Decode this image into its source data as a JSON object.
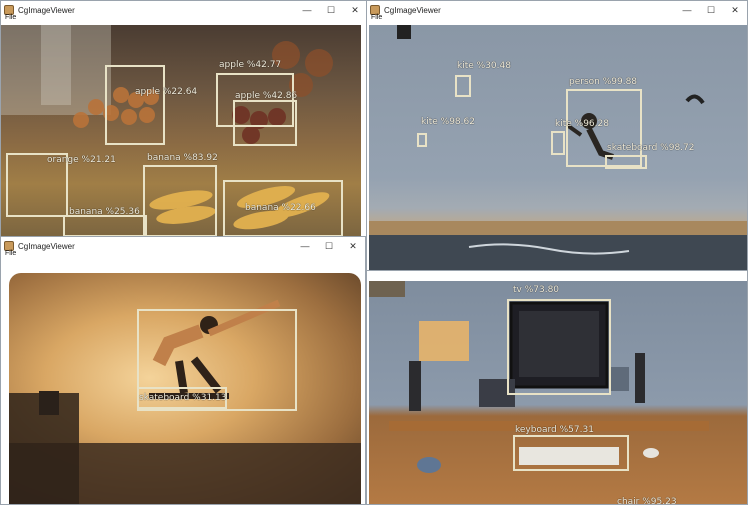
{
  "windows": [
    {
      "title": "CgImageViewer",
      "menu": "File",
      "detections": [
        {
          "label": "apple %42.77",
          "class": "apple"
        },
        {
          "label": "apple %42.86",
          "class": "apple"
        },
        {
          "label": "apple %22.64",
          "class": "apple"
        },
        {
          "label": "orange %21.21",
          "class": "orange"
        },
        {
          "label": "banana %83.92",
          "class": "banana"
        },
        {
          "label": "banana %25.36",
          "class": "banana"
        },
        {
          "label": "banana %22.66",
          "class": "banana"
        }
      ]
    },
    {
      "title": "CgImageViewer",
      "menu": "File",
      "detections": [
        {
          "label": "person %99.88",
          "class": "person"
        },
        {
          "label": "skateboard %98.72",
          "class": "skateboard"
        },
        {
          "label": "kite %98.62",
          "class": "kite"
        },
        {
          "label": "kite %96.28",
          "class": "kite"
        },
        {
          "label": "kite %30.48",
          "class": "kite"
        }
      ]
    },
    {
      "title": "CgImageViewer",
      "menu": "File",
      "detections": [
        {
          "label": "skateboard %31.13",
          "class": "skateboard"
        }
      ]
    },
    {
      "title": "CgImageViewer",
      "menu": "File",
      "detections": [
        {
          "label": "tv %73.80",
          "class": "tv"
        },
        {
          "label": "keyboard %57.31",
          "class": "keyboard"
        },
        {
          "label": "chair %95.23",
          "class": "chair"
        }
      ]
    }
  ],
  "window_controls": {
    "minimize": "—",
    "maximize": "☐",
    "close": "✕"
  },
  "icons": {
    "app": "image-viewer-icon"
  }
}
